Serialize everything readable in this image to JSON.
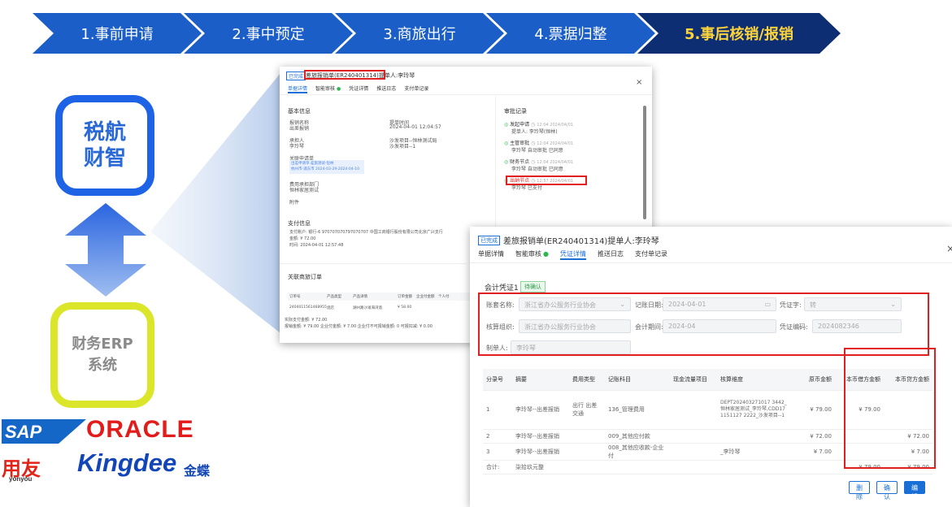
{
  "steps": [
    "1.事前申请",
    "2.事中预定",
    "3.商旅出行",
    "4.票据归整",
    "5.事后核销/报销"
  ],
  "logo1": [
    "税航",
    "财智"
  ],
  "logo2": [
    "财务ERP",
    "系统"
  ],
  "brands": {
    "sap": "SAP",
    "oracle": "ORACLE",
    "yonyou": "用友",
    "yonyou_sub": "yonyou",
    "kingdee": "Kingdee",
    "kingdee_cn": "金蝶"
  },
  "back": {
    "status": "已完成",
    "title": "差旅报销单(ER240401314)提单人:李玲琴",
    "tabs": [
      "单据详情",
      "智能审核",
      "凭证详情",
      "推送日志",
      "支付单记录"
    ],
    "basic_title": "基本信息",
    "f1_label": "报销名称",
    "f1_value": "出差报销",
    "f2_label": "提单时间",
    "f2_value": "2024-04-01 12:04:57",
    "f3_label": "承担人",
    "f3_value": "李玲琴",
    "f4_label": "",
    "f4_value": "沙发项目--恒林测试局",
    "f4_value2": "沙发项目--1",
    "rel_label": "关联申请单",
    "rel_text1": "出差申请单·差旅测试·恒林",
    "rel_text2": "杭州市-浦东市 2024-03-29-2024-04-10",
    "dept_label": "费用承担部门",
    "dept_value": "恒林家居测试",
    "attach_label": "附件",
    "pay_title": "支付信息",
    "pay_account": "支付账户: 银行-6 970707070797070707 中国工商银行股份有限公司北京广兴支行",
    "pay_amount": "金额: ¥ 72.00",
    "pay_time": "时间: 2024-04-01 12:57:48",
    "order_title": "关联商旅订单",
    "order_cols": [
      "订单号",
      "产品类型",
      "产品详情",
      "订单金额",
      "企业付金额",
      "个人付"
    ],
    "order_row": [
      "2404011561468955",
      "酒店",
      "湖州路沙滩海湾酒",
      "¥ 58.00"
    ],
    "foot1": "实际支付金额: ¥ 72.00",
    "foot2": "报销金额: ¥ 79.00 企业付金额: ¥ 7.00 企业付不可报销金额: 0 可报扣减: ¥ 0.00",
    "audit_title": "审批记录",
    "audit": [
      {
        "t": "发起申请",
        "time": "12:04 2024/04/01",
        "d": "提单人: 李玲琴(恒林)"
      },
      {
        "t": "主管审批",
        "time": "12:04 2024/04/01",
        "d": "李玲琴 自动审批 已同意"
      },
      {
        "t": "财务节点",
        "time": "12:04 2024/04/01",
        "d": "李玲琴 自动审批 已同意"
      },
      {
        "t": "出纳节点",
        "time": "12:57 2024/04/01",
        "d": "李玲琴 已支付"
      }
    ]
  },
  "front": {
    "status": "已完成",
    "title": "差旅报销单(ER240401314)提单人:李玲琴",
    "tabs": [
      "单据详情",
      "智能审核",
      "凭证详情",
      "推送日志",
      "支付单记录"
    ],
    "voucher_label": "会计凭证1",
    "voucher_badge": "待确认",
    "l_account": "账套名称:",
    "v_account": "浙江省办公服务行业协会",
    "l_date": "记账日期:",
    "v_date": "2024-04-01",
    "l_word": "凭证字:",
    "v_word": "转",
    "l_org": "核算组织:",
    "v_org": "浙江省办公服务行业协会",
    "l_period": "会计期间:",
    "v_period": "2024-04",
    "l_code": "凭证编码:",
    "v_code": "2024082346",
    "l_maker": "制单人:",
    "v_maker": "李玲琴",
    "cols": [
      "分录号",
      "摘要",
      "费用类型",
      "记账科目",
      "现金流量项目",
      "核算维度",
      "原币金额",
      "本币借方金额",
      "本币贷方金额"
    ],
    "rows": [
      [
        "1",
        "李玲琴--出差报销",
        "出行 出差交通",
        "136_管理费用",
        "",
        "DEPT202403271017 3442_恒林家居测试_李玲琴,CDD171151127 2222_沙发项目--1",
        "¥ 79.00",
        "¥ 79.00",
        ""
      ],
      [
        "2",
        "李玲琴--出差报销",
        "",
        "009_其他应付款",
        "",
        "",
        "¥ 72.00",
        "",
        "¥ 72.00"
      ],
      [
        "3",
        "李玲琴--出差报销",
        "",
        "008_其他应收款-企业付",
        "",
        "_李玲琴",
        "¥ 7.00",
        "",
        "¥ 7.00"
      ]
    ],
    "total": [
      "合计:",
      "柒拾玖元整",
      "",
      "",
      "",
      "",
      "",
      "¥ 79.00",
      "¥ 79.00"
    ],
    "buttons": [
      "删 除",
      "确 认",
      "编 辑"
    ]
  },
  "colors": {
    "step": "#1b5ec7",
    "step_active": "#0d2e73",
    "accent": "#ffd43b",
    "blue": "#1a6fd6",
    "red": "#e02020",
    "yellow": "#d6e02a"
  }
}
